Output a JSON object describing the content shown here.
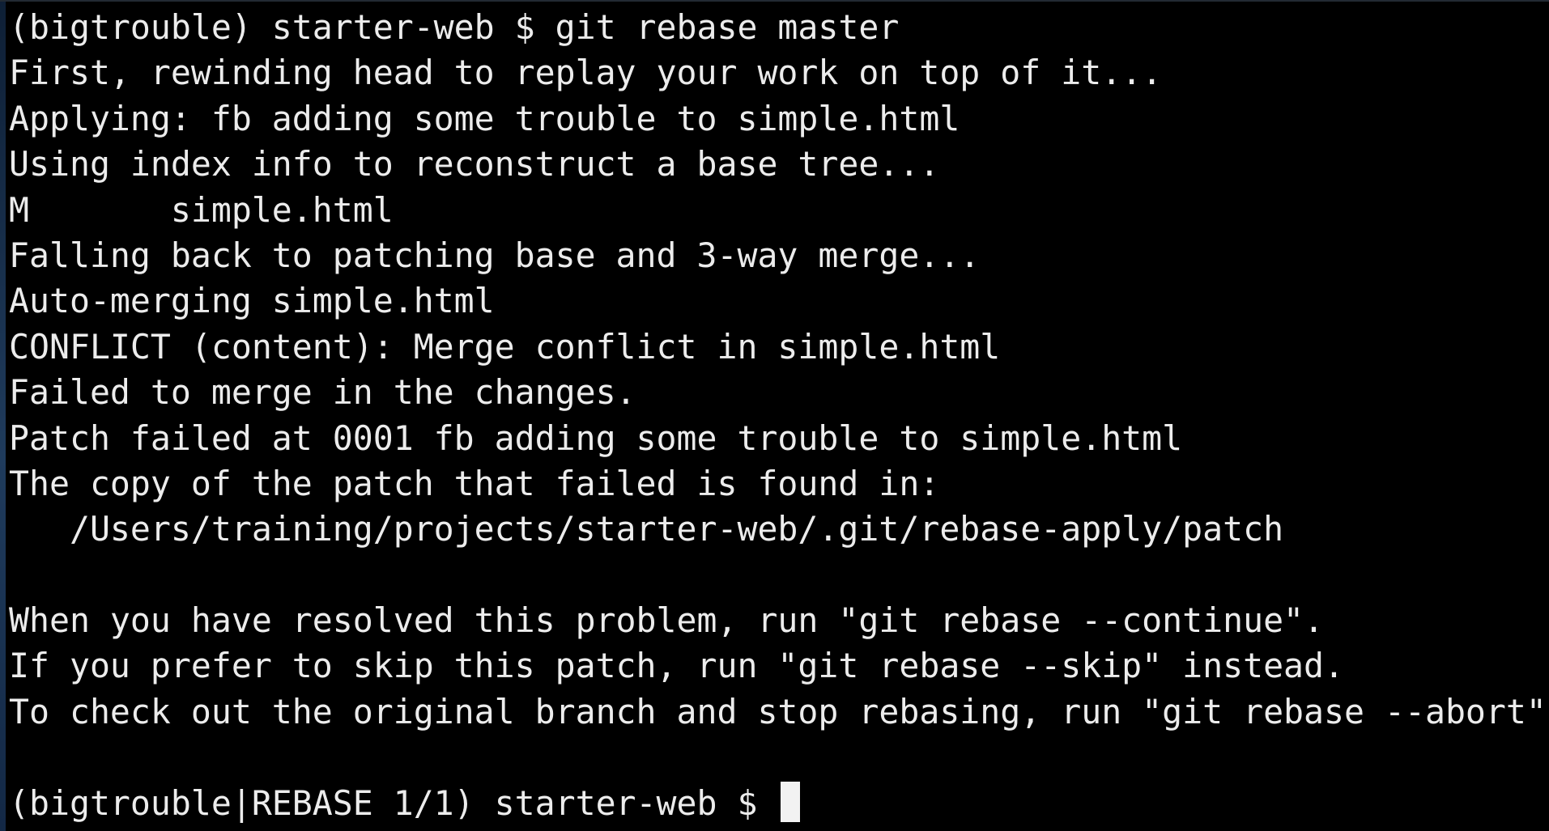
{
  "terminal": {
    "lines": [
      "(bigtrouble) starter-web $ git rebase master",
      "First, rewinding head to replay your work on top of it...",
      "Applying: fb adding some trouble to simple.html",
      "Using index info to reconstruct a base tree...",
      "M       simple.html",
      "Falling back to patching base and 3-way merge...",
      "Auto-merging simple.html",
      "CONFLICT (content): Merge conflict in simple.html",
      "Failed to merge in the changes.",
      "Patch failed at 0001 fb adding some trouble to simple.html",
      "The copy of the patch that failed is found in:",
      "   /Users/training/projects/starter-web/.git/rebase-apply/patch",
      "",
      "When you have resolved this problem, run \"git rebase --continue\".",
      "If you prefer to skip this patch, run \"git rebase --skip\" instead.",
      "To check out the original branch and stop rebasing, run \"git rebase --abort\".",
      ""
    ],
    "prompt": "(bigtrouble|REBASE 1/1) starter-web $ "
  },
  "colors": {
    "background": "#000000",
    "foreground": "#ececec",
    "cursor": "#f2f2f2"
  }
}
